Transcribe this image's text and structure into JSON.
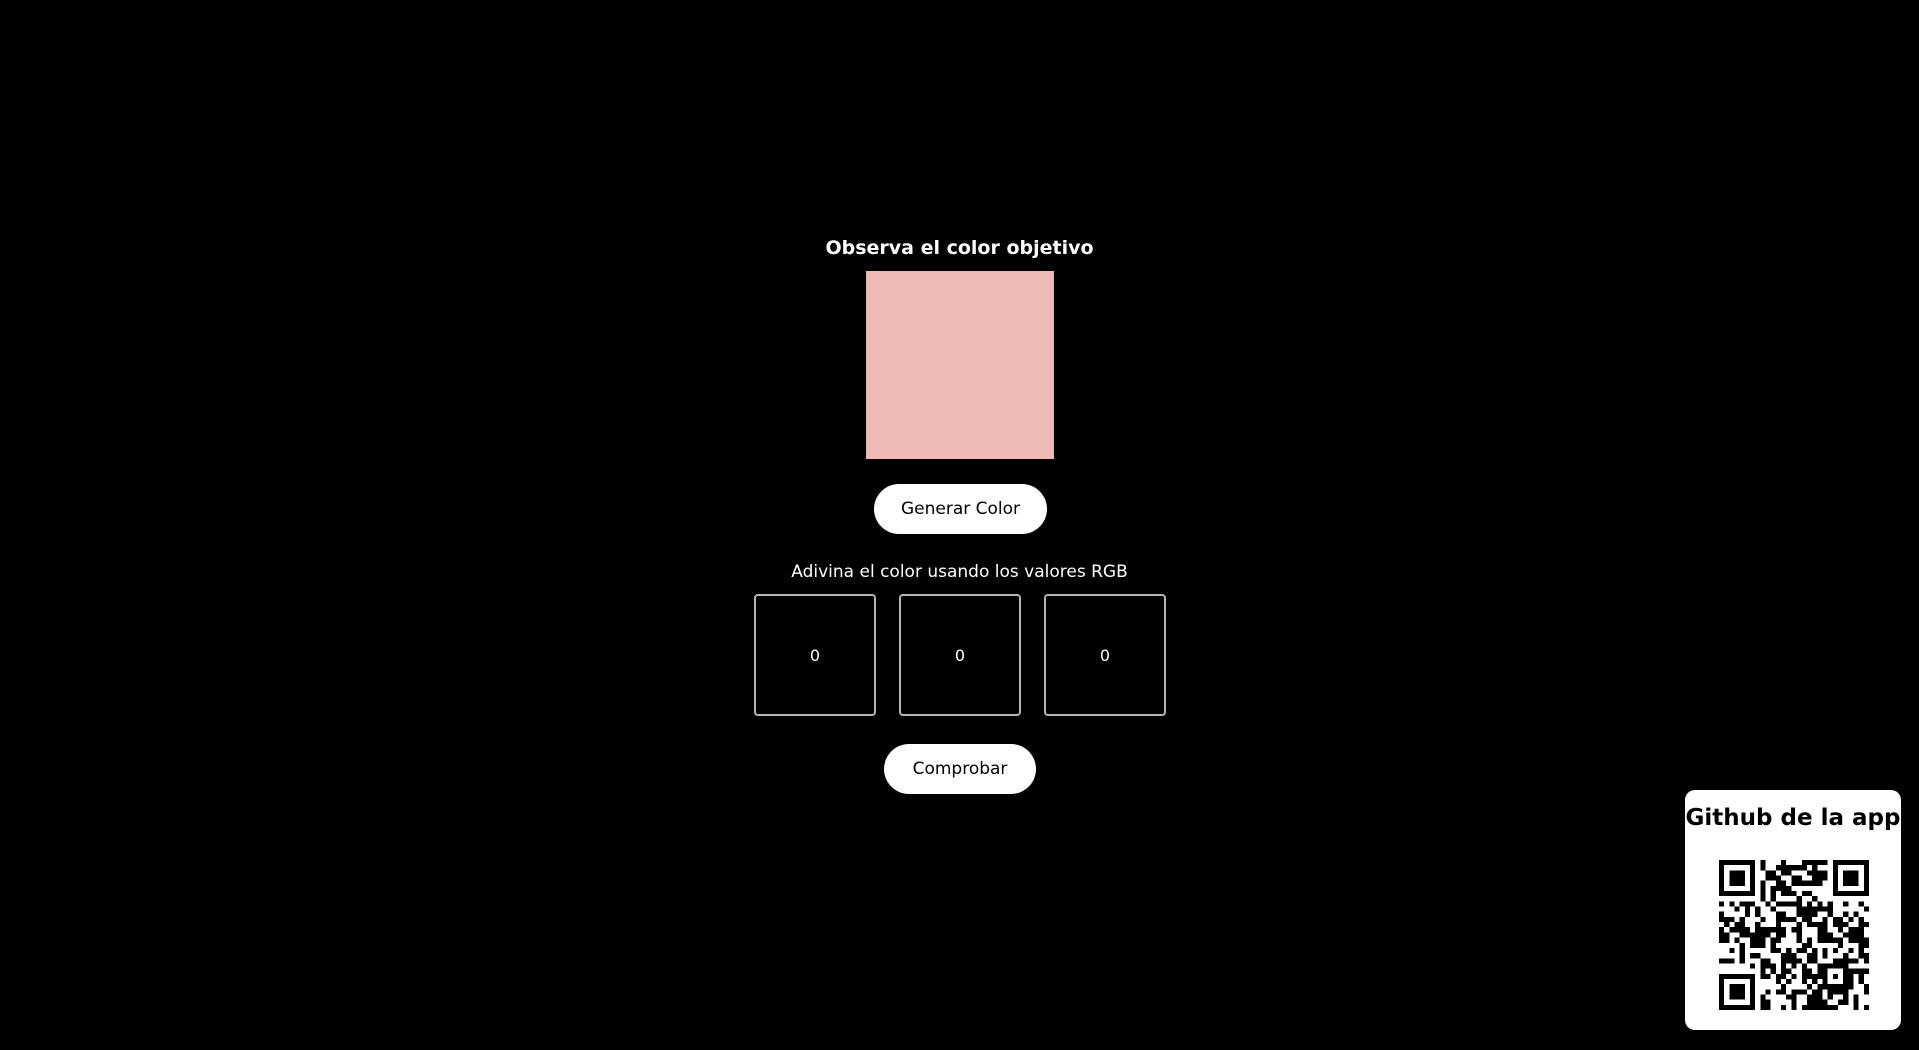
{
  "target": {
    "title": "Observa el color objetivo",
    "swatch_color": "#edbbb4"
  },
  "buttons": {
    "generate_label": "Generar Color",
    "check_label": "Comprobar"
  },
  "guess": {
    "instructions": "Adivina el color usando los valores RGB",
    "r_value": "0",
    "g_value": "0",
    "b_value": "0"
  },
  "qr_card": {
    "title": "Github de la app",
    "icon": "qr-code-icon"
  },
  "colors": {
    "background": "#000000",
    "text": "#ffffff",
    "button_bg": "#ffffff",
    "button_text": "#000000",
    "input_border": "#b5b5b5"
  }
}
